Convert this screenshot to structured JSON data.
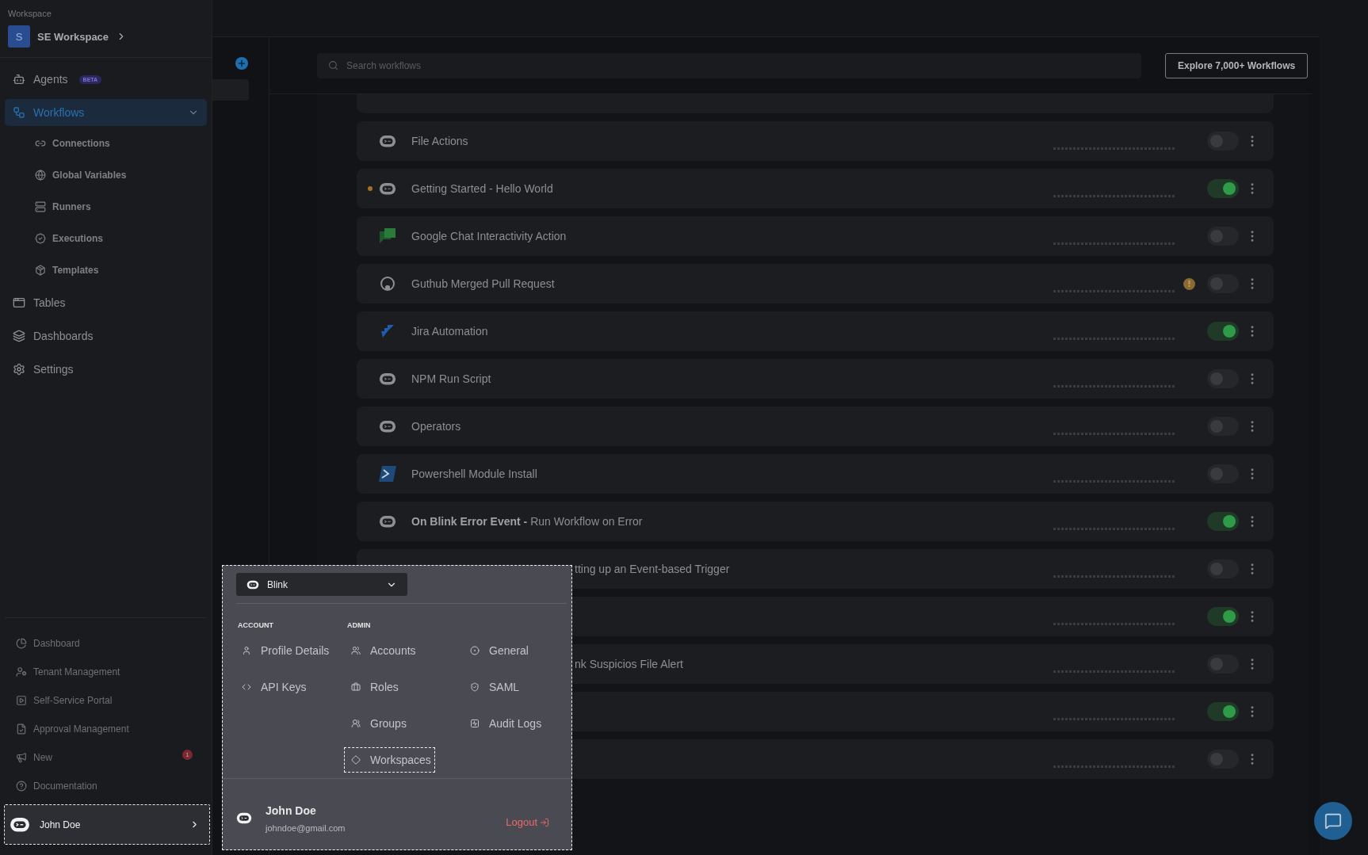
{
  "sidebar": {
    "workspace_label": "Workspace",
    "workspace": {
      "initial": "S",
      "name": "SE Workspace"
    },
    "nav": [
      {
        "label": "Agents",
        "badge": "BETA",
        "selected": false
      },
      {
        "label": "Workflows",
        "selected": true,
        "expanded": true,
        "children": [
          {
            "label": "Connections"
          },
          {
            "label": "Global Variables"
          },
          {
            "label": "Runners"
          },
          {
            "label": "Executions"
          },
          {
            "label": "Templates"
          }
        ]
      },
      {
        "label": "Tables",
        "selected": false
      },
      {
        "label": "Dashboards",
        "selected": false
      },
      {
        "label": "Settings",
        "selected": false
      }
    ],
    "footer_nav": [
      {
        "label": "Dashboard"
      },
      {
        "label": "Tenant Management"
      },
      {
        "label": "Self-Service Portal"
      },
      {
        "label": "Approval Management"
      },
      {
        "label": "New",
        "badge": "1"
      },
      {
        "label": "Documentation"
      }
    ],
    "user": {
      "name": "John Doe",
      "selected": true
    }
  },
  "toolbar": {
    "search": {
      "placeholder": "Search workflows"
    },
    "explore_button": "Explore 7,000+ Workflows"
  },
  "workflows": [
    {
      "kind": "blink",
      "name": "File Actions",
      "changed": false,
      "warning": false,
      "on": false
    },
    {
      "kind": "blink",
      "name": "Getting Started - Hello World",
      "changed": true,
      "warning": false,
      "on": true
    },
    {
      "kind": "google_chat",
      "name": "Google Chat Interactivity Action",
      "changed": false,
      "warning": false,
      "on": false
    },
    {
      "kind": "github",
      "name": "Guthub Merged Pull Request",
      "changed": false,
      "warning": true,
      "on": false
    },
    {
      "kind": "jira",
      "name": "Jira Automation",
      "changed": false,
      "warning": false,
      "on": true
    },
    {
      "kind": "blink",
      "name": "NPM Run Script",
      "changed": false,
      "warning": false,
      "on": false
    },
    {
      "kind": "blink",
      "name": "Operators",
      "changed": false,
      "warning": false,
      "on": false
    },
    {
      "kind": "powershell",
      "name": "Powershell Module Install",
      "changed": false,
      "warning": false,
      "on": false
    },
    {
      "kind": "blink",
      "name": "**On Blink Error Event -** Run Workflow on Error",
      "changed": false,
      "warning": false,
      "on": true
    },
    {
      "kind": "covered",
      "name": "tting up an Event-based Trigger",
      "changed": false,
      "warning": false,
      "on": false
    },
    {
      "kind": "covered",
      "changed": false,
      "warning": false,
      "on": true
    },
    {
      "kind": "covered",
      "name": "nk Suspicios File Alert",
      "changed": false,
      "warning": false,
      "on": false
    },
    {
      "kind": "covered",
      "changed": false,
      "warning": false,
      "on": true
    },
    {
      "kind": "covered",
      "changed": false,
      "warning": false,
      "on": false
    }
  ],
  "account_menu": {
    "org_select": "Blink",
    "account": {
      "heading": "ACCOUNT",
      "items": [
        {
          "label": "Profile Details",
          "focused": false
        },
        {
          "label": "API Keys",
          "focused": false
        }
      ]
    },
    "admin": {
      "heading": "ADMIN",
      "items": [
        {
          "label": "Accounts",
          "focused": false
        },
        {
          "label": "General",
          "focused": false
        },
        {
          "label": "Roles",
          "focused": false
        },
        {
          "label": "SAML",
          "focused": false
        },
        {
          "label": "Groups",
          "focused": false
        },
        {
          "label": "Audit Logs",
          "focused": false
        },
        {
          "label": "Workspaces",
          "focused": true
        }
      ]
    },
    "user": {
      "name": "John Doe",
      "email": "johndoe@gmail.com"
    },
    "logout": "Logout"
  }
}
